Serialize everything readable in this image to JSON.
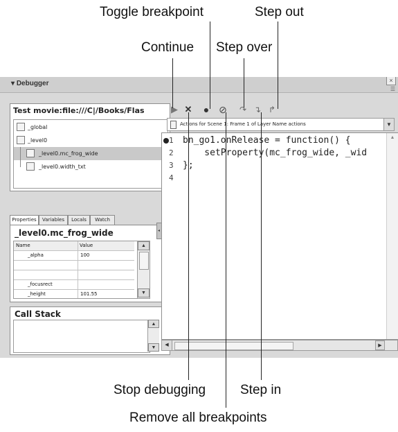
{
  "callouts": {
    "toggle_breakpoint": "Toggle breakpoint",
    "step_out": "Step out",
    "continue": "Continue",
    "step_over": "Step over",
    "stop_debugging": "Stop debugging",
    "step_in": "Step in",
    "remove_all_breakpoints": "Remove all breakpoints"
  },
  "panel": {
    "title": "Debugger",
    "movie_path": "Test movie:file:///C|/Books/Flas",
    "tree": [
      "_global",
      "_level0",
      "_level0.mc_frog_wide",
      "_level0.width_txt"
    ]
  },
  "tabs": [
    "Properties",
    "Variables",
    "Locals",
    "Watch"
  ],
  "properties": {
    "target": "_level0.mc_frog_wide",
    "headers": [
      "Name",
      "Value"
    ],
    "rows": [
      {
        "name": "_alpha",
        "value": "100"
      },
      {
        "name": "",
        "value": ""
      },
      {
        "name": "",
        "value": ""
      },
      {
        "name": "_focusrect",
        "value": ""
      },
      {
        "name": "_height",
        "value": "101.55"
      }
    ]
  },
  "call_stack": {
    "title": "Call Stack"
  },
  "actions_dropdown": "Actions for Scene 1: Frame 1 of Layer Name actions",
  "code_lines": [
    {
      "num": "1",
      "text": "bn_go1.onRelease = function() {"
    },
    {
      "num": "2",
      "text": "    setProperty(mc_frog_wide, _wid"
    },
    {
      "num": "3",
      "text": "};"
    },
    {
      "num": "4",
      "text": ""
    }
  ],
  "colors": {
    "breakpoint": "#222222",
    "selection": "#c9c9c9"
  },
  "icons": [
    "continue-icon",
    "stop-debugging-icon",
    "toggle-breakpoint-icon",
    "remove-all-breakpoints-icon",
    "step-over-icon",
    "step-in-icon",
    "step-out-icon"
  ]
}
